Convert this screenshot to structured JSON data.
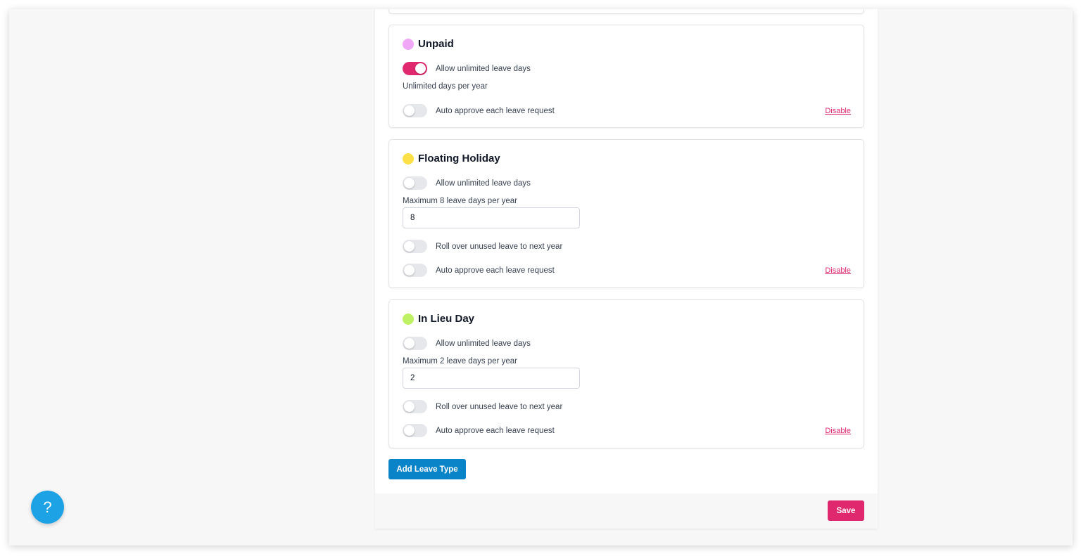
{
  "leave_types": [
    {
      "name": "Unpaid",
      "color": "#f0a7f5",
      "unlimited_label": "Allow unlimited leave days",
      "unlimited_on": true,
      "days_text": "Unlimited days per year",
      "auto_approve_label": "Auto approve each leave request",
      "auto_approve_on": false,
      "disable_label": "Disable"
    },
    {
      "name": "Floating Holiday",
      "color": "#fde047",
      "unlimited_label": "Allow unlimited leave days",
      "unlimited_on": false,
      "days_text": "Maximum 8 leave days per year",
      "max_days_value": "8",
      "rollover_label": "Roll over unused leave to next year",
      "rollover_on": false,
      "auto_approve_label": "Auto approve each leave request",
      "auto_approve_on": false,
      "disable_label": "Disable"
    },
    {
      "name": "In Lieu Day",
      "color": "#bef264",
      "unlimited_label": "Allow unlimited leave days",
      "unlimited_on": false,
      "days_text": "Maximum 2 leave days per year",
      "max_days_value": "2",
      "rollover_label": "Roll over unused leave to next year",
      "rollover_on": false,
      "auto_approve_label": "Auto approve each leave request",
      "auto_approve_on": false,
      "disable_label": "Disable"
    }
  ],
  "add_leave_type_label": "Add Leave Type",
  "save_label": "Save",
  "help_label": "?",
  "colors": {
    "accent_pink": "#e0286e",
    "primary_blue": "#0a84c9",
    "help_blue": "#1ea2e6"
  }
}
